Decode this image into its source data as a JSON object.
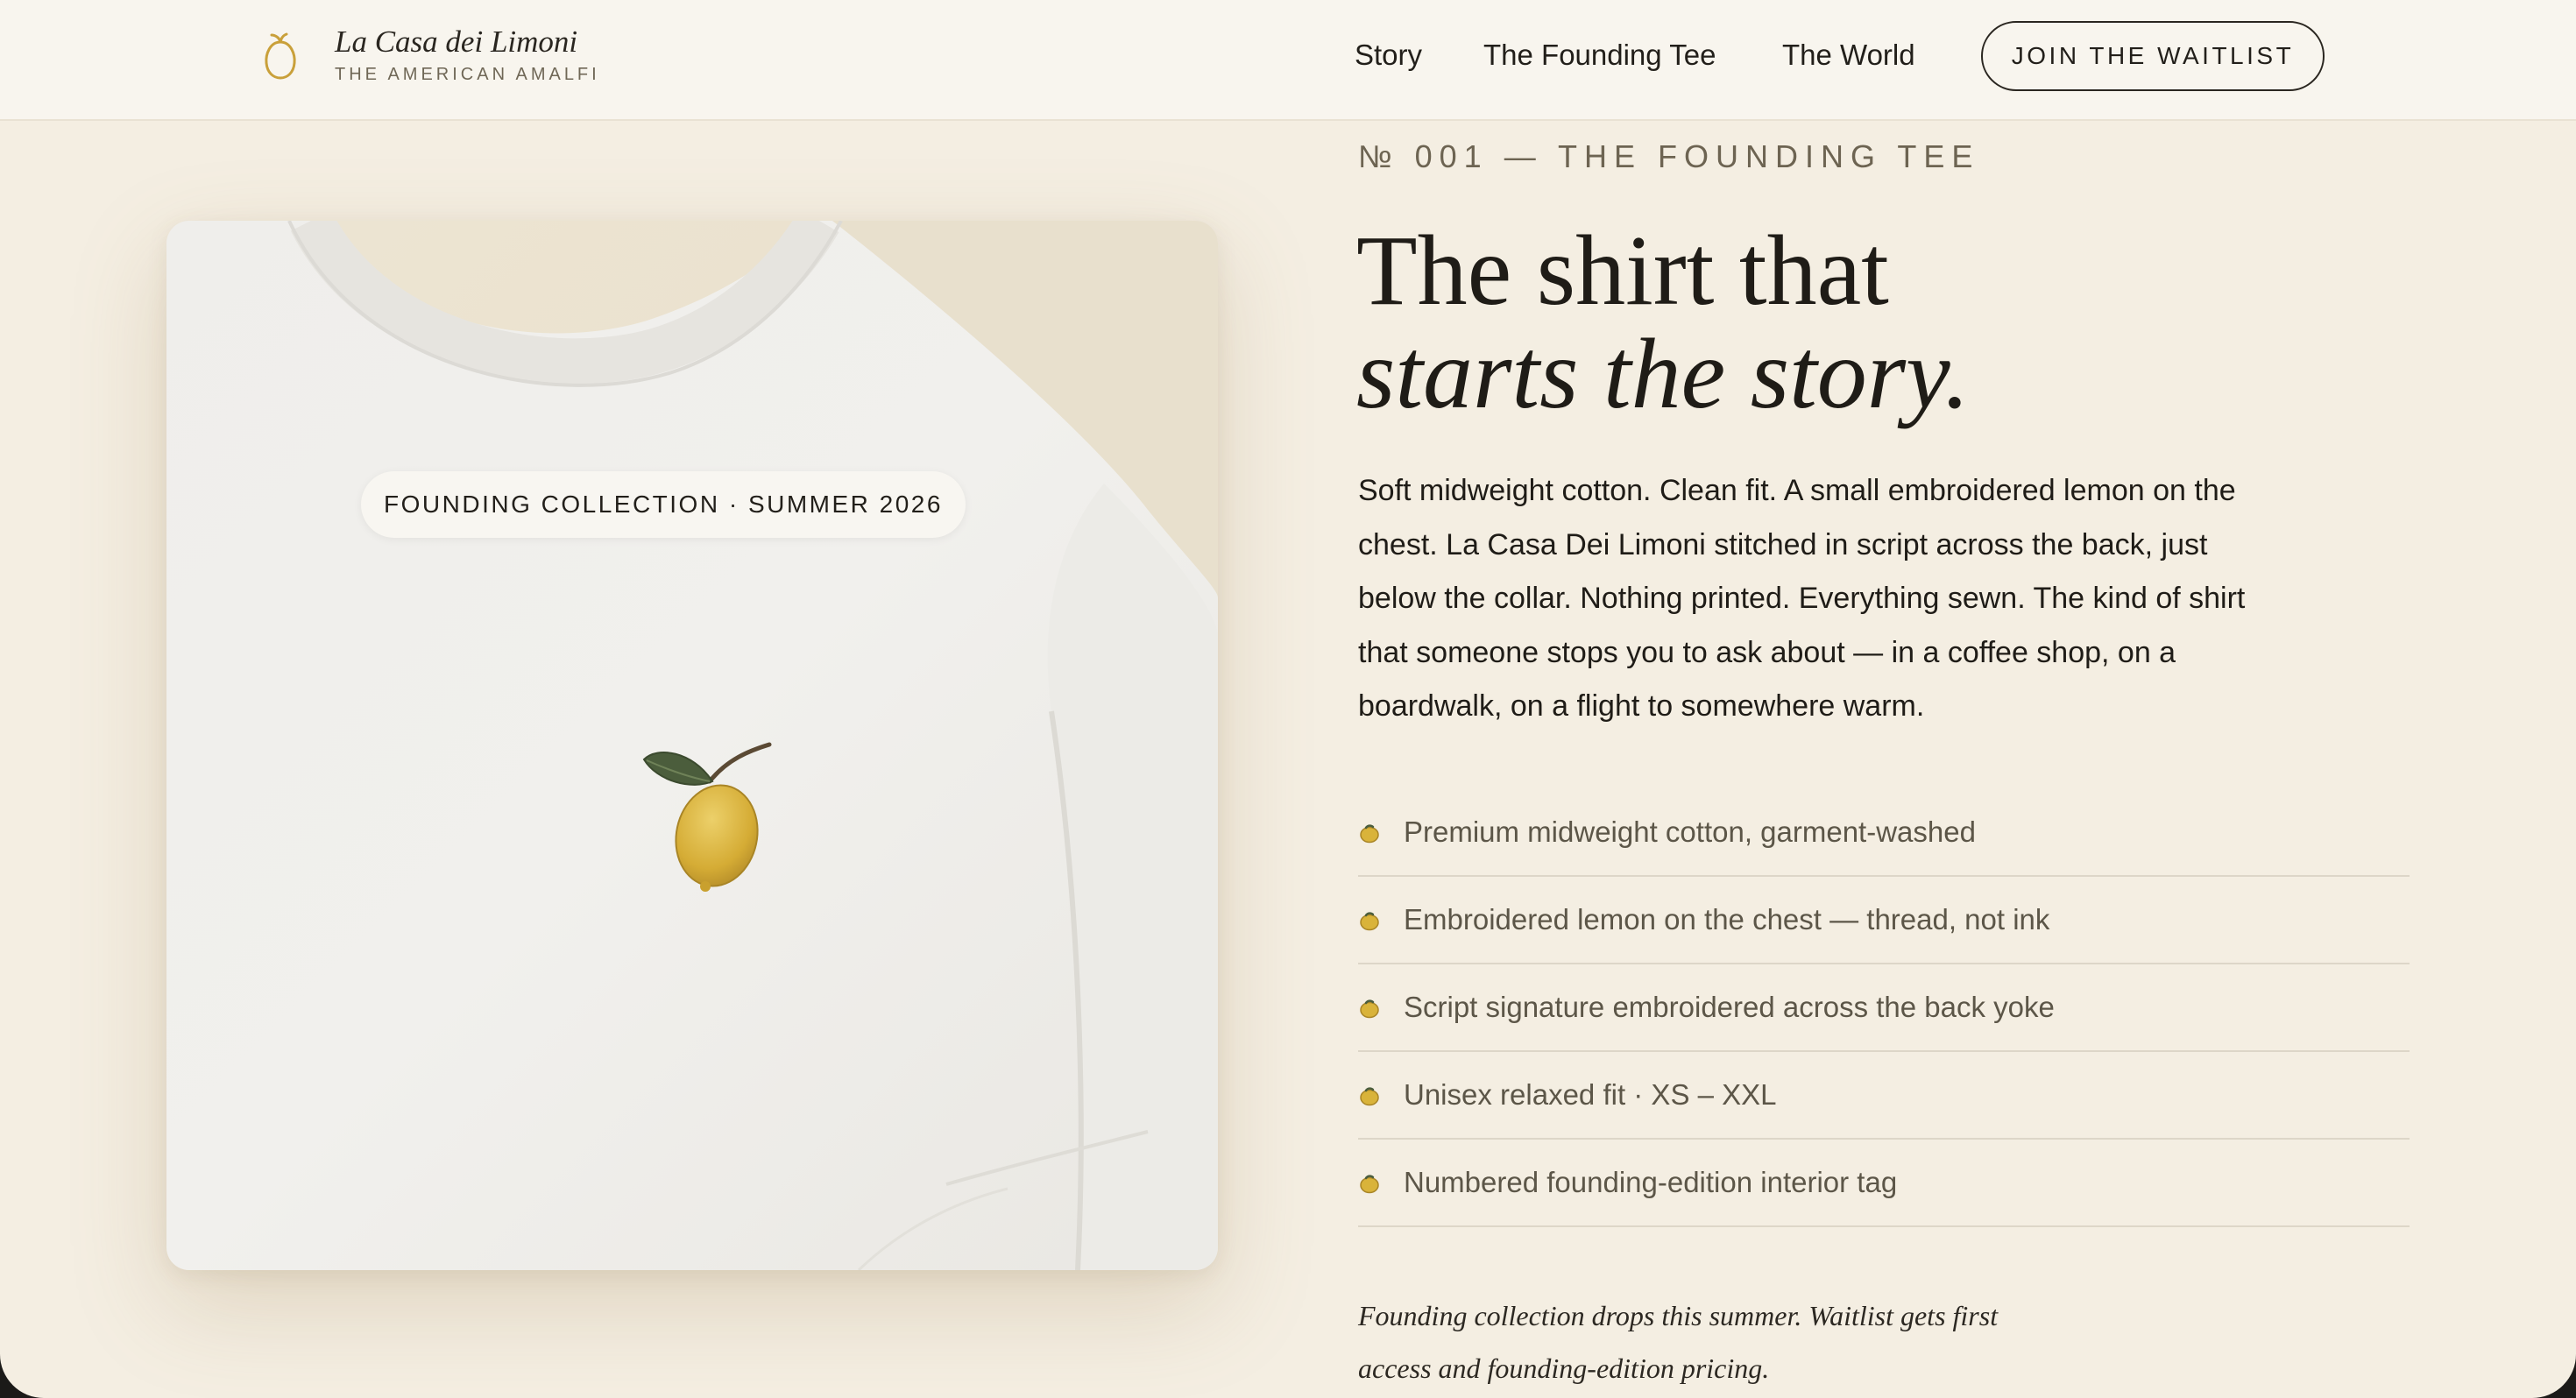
{
  "header": {
    "brand_name": "La Casa dei Limoni",
    "brand_tagline": "THE AMERICAN AMALFI",
    "brand_icon": "lemon-outline-icon",
    "nav": [
      {
        "label": "Story"
      },
      {
        "label": "The Founding Tee"
      },
      {
        "label": "The World"
      }
    ],
    "cta_label": "JOIN THE WAITLIST"
  },
  "product": {
    "badge": "FOUNDING COLLECTION · SUMMER 2026",
    "image_icon": "embroidered-lemon-icon"
  },
  "content": {
    "eyebrow": "№ 001 — THE FOUNDING TEE",
    "headline_line1": "The shirt that",
    "headline_line2": "starts the story.",
    "description": "Soft midweight cotton. Clean fit. A small embroidered lemon on the chest. La Casa Dei Limoni stitched in script across the back, just below the collar. Nothing printed. Everything sewn. The kind of shirt that someone stops you to ask about — in a coffee shop, on a boardwalk, on a flight to somewhere warm.",
    "features": [
      {
        "text": "Premium midweight cotton, garment-washed",
        "icon": "lemon-bullet-icon"
      },
      {
        "text": "Embroidered lemon on the chest — thread, not ink",
        "icon": "lemon-bullet-icon"
      },
      {
        "text": "Script signature embroidered across the back yoke",
        "icon": "lemon-bullet-icon"
      },
      {
        "text": "Unisex relaxed fit · XS – XXL",
        "icon": "lemon-bullet-icon"
      },
      {
        "text": "Numbered founding-edition interior tag",
        "icon": "lemon-bullet-icon"
      }
    ],
    "note": "Founding collection drops this summer. Waitlist gets first access and founding-edition pricing."
  },
  "colors": {
    "page_background": "#f4eee2",
    "header_background": "#f8f5ee",
    "text_primary": "#1f1c17",
    "text_muted": "#5c5648",
    "lemon_yellow": "#d9b33a",
    "leaf_green": "#4b5d3c"
  }
}
